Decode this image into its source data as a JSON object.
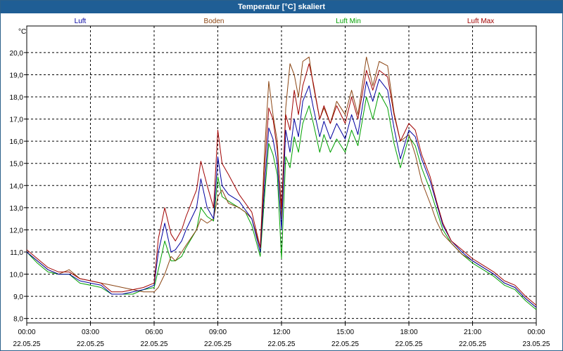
{
  "window": {
    "title": "Temperatur [°C] skaliert"
  },
  "legend": [
    {
      "name": "Luft",
      "color": "#0000a0"
    },
    {
      "name": "Boden",
      "color": "#8b4513"
    },
    {
      "name": "Luft Min",
      "color": "#00a000"
    },
    {
      "name": "Luft Max",
      "color": "#a00000"
    }
  ],
  "chart_data": {
    "type": "line",
    "title": "Temperatur [°C] skaliert",
    "xlabel": "",
    "ylabel": "°C",
    "unit_label": "°C",
    "ylim": [
      7.8,
      21.2
    ],
    "xlim": [
      0,
      24
    ],
    "grid": true,
    "grid_style": "dashed",
    "legend_position": "top",
    "y_ticks": [
      "8,0",
      "9,0",
      "10,0",
      "11,0",
      "12,0",
      "13,0",
      "14,0",
      "15,0",
      "16,0",
      "17,0",
      "18,0",
      "19,0",
      "20,0"
    ],
    "y_tick_values": [
      8,
      9,
      10,
      11,
      12,
      13,
      14,
      15,
      16,
      17,
      18,
      19,
      20
    ],
    "x_ticks": [
      {
        "time": "00:00",
        "date": "22.05.25"
      },
      {
        "time": "03:00",
        "date": "22.05.25"
      },
      {
        "time": "06:00",
        "date": "22.05.25"
      },
      {
        "time": "09:00",
        "date": "22.05.25"
      },
      {
        "time": "12:00",
        "date": "22.05.25"
      },
      {
        "time": "15:00",
        "date": "22.05.25"
      },
      {
        "time": "18:00",
        "date": "22.05.25"
      },
      {
        "time": "21:00",
        "date": "22.05.25"
      },
      {
        "time": "00:00",
        "date": "23.05.25"
      }
    ],
    "x_tick_values": [
      0,
      3,
      6,
      9,
      12,
      15,
      18,
      21,
      24
    ],
    "series": [
      {
        "name": "Luft",
        "color": "#0000a0",
        "x": [
          0,
          0.5,
          1,
          1.5,
          2,
          2.5,
          3,
          3.5,
          4,
          4.5,
          5,
          5.5,
          6,
          6.2,
          6.5,
          6.8,
          7,
          7.3,
          7.5,
          8,
          8.2,
          8.5,
          8.8,
          9,
          9.2,
          9.5,
          10,
          10.3,
          10.6,
          11,
          11.2,
          11.4,
          11.6,
          11.8,
          12,
          12.2,
          12.4,
          12.6,
          12.8,
          13,
          13.3,
          13.5,
          13.8,
          14,
          14.3,
          14.6,
          15,
          15.3,
          15.6,
          16,
          16.3,
          16.6,
          17,
          17.3,
          17.6,
          18,
          18.3,
          18.6,
          19,
          19.3,
          19.6,
          20,
          20.5,
          21,
          21.5,
          22,
          22.5,
          23,
          23.5,
          24
        ],
        "values": [
          11.0,
          10.6,
          10.2,
          10.0,
          10.0,
          9.7,
          9.6,
          9.5,
          9.1,
          9.1,
          9.2,
          9.3,
          9.5,
          11.0,
          12.3,
          11.0,
          11.1,
          11.5,
          12.0,
          13.0,
          14.3,
          13.0,
          12.5,
          15.3,
          14.0,
          13.6,
          13.3,
          12.9,
          12.5,
          11.0,
          14.0,
          16.6,
          16.1,
          15.0,
          12.0,
          16.5,
          15.5,
          17.0,
          16.2,
          17.8,
          18.5,
          17.5,
          16.2,
          16.9,
          16.1,
          16.8,
          16.1,
          17.2,
          16.3,
          18.7,
          17.8,
          18.8,
          18.3,
          16.6,
          15.2,
          16.5,
          16.2,
          15.2,
          14.2,
          13.2,
          12.2,
          11.5,
          11.0,
          10.6,
          10.3,
          10.0,
          9.6,
          9.4,
          8.9,
          8.5
        ]
      },
      {
        "name": "Boden",
        "color": "#8b4513",
        "x": [
          0,
          0.5,
          1,
          1.5,
          2,
          2.5,
          3,
          3.5,
          4,
          4.5,
          5,
          5.5,
          6,
          6.2,
          6.5,
          6.8,
          7,
          7.3,
          7.5,
          8,
          8.2,
          8.5,
          8.8,
          9,
          9.2,
          9.5,
          10,
          10.3,
          10.6,
          11,
          11.2,
          11.4,
          11.6,
          11.8,
          12,
          12.2,
          12.4,
          12.6,
          12.8,
          13,
          13.3,
          13.5,
          13.8,
          14,
          14.3,
          14.6,
          15,
          15.3,
          15.6,
          16,
          16.3,
          16.6,
          17,
          17.3,
          17.6,
          18,
          18.3,
          18.6,
          19,
          19.3,
          19.6,
          20,
          20.5,
          21,
          21.5,
          22,
          22.5,
          23,
          23.5,
          24
        ],
        "values": [
          11.0,
          10.6,
          10.2,
          10.0,
          10.2,
          9.8,
          9.7,
          9.6,
          9.5,
          9.4,
          9.3,
          9.2,
          9.2,
          9.4,
          10.0,
          10.8,
          10.6,
          11.0,
          11.3,
          12.0,
          12.5,
          12.3,
          12.5,
          13.5,
          13.8,
          13.2,
          13.0,
          12.8,
          12.5,
          11.2,
          15.5,
          18.7,
          17.2,
          16.0,
          12.5,
          17.5,
          19.5,
          19.0,
          18.0,
          19.6,
          19.8,
          18.5,
          17.0,
          17.5,
          16.8,
          17.8,
          17.2,
          18.3,
          17.2,
          19.8,
          18.5,
          19.6,
          19.4,
          17.3,
          16.0,
          16.3,
          15.4,
          14.2,
          13.2,
          12.4,
          11.8,
          11.4,
          10.9,
          10.6,
          10.3,
          10.0,
          9.6,
          9.4,
          8.9,
          8.5
        ]
      },
      {
        "name": "Luft Min",
        "color": "#00a000",
        "x": [
          0,
          0.5,
          1,
          1.5,
          2,
          2.5,
          3,
          3.5,
          4,
          4.5,
          5,
          5.5,
          6,
          6.2,
          6.5,
          6.8,
          7,
          7.3,
          7.5,
          8,
          8.2,
          8.5,
          8.8,
          9,
          9.2,
          9.5,
          10,
          10.3,
          10.6,
          11,
          11.2,
          11.4,
          11.6,
          11.8,
          12,
          12.2,
          12.4,
          12.6,
          12.8,
          13,
          13.3,
          13.5,
          13.8,
          14,
          14.3,
          14.6,
          15,
          15.3,
          15.6,
          16,
          16.3,
          16.6,
          17,
          17.3,
          17.6,
          18,
          18.3,
          18.6,
          19,
          19.3,
          19.6,
          20,
          20.5,
          21,
          21.5,
          22,
          22.5,
          23,
          23.5,
          24
        ],
        "values": [
          11.0,
          10.5,
          10.1,
          10.0,
          10.0,
          9.6,
          9.5,
          9.4,
          9.1,
          9.1,
          9.1,
          9.3,
          9.4,
          10.2,
          11.5,
          10.6,
          10.6,
          10.8,
          11.2,
          12.0,
          13.0,
          12.6,
          12.4,
          14.4,
          13.5,
          13.3,
          13.0,
          12.8,
          12.2,
          10.8,
          13.5,
          15.9,
          15.4,
          14.5,
          10.7,
          15.3,
          14.8,
          16.2,
          15.5,
          16.8,
          17.6,
          16.8,
          15.5,
          16.3,
          15.5,
          16.1,
          15.5,
          16.5,
          15.8,
          18.0,
          17.0,
          18.2,
          17.5,
          15.9,
          14.8,
          16.2,
          15.8,
          14.8,
          13.8,
          12.9,
          12.0,
          11.4,
          10.9,
          10.5,
          10.2,
          9.9,
          9.5,
          9.3,
          8.8,
          8.4
        ]
      },
      {
        "name": "Luft Max",
        "color": "#a00000",
        "x": [
          0,
          0.5,
          1,
          1.5,
          2,
          2.5,
          3,
          3.5,
          4,
          4.5,
          5,
          5.5,
          6,
          6.2,
          6.5,
          6.8,
          7,
          7.3,
          7.5,
          8,
          8.2,
          8.5,
          8.8,
          9,
          9.2,
          9.5,
          10,
          10.3,
          10.6,
          11,
          11.2,
          11.4,
          11.6,
          11.8,
          12,
          12.2,
          12.4,
          12.6,
          12.8,
          13,
          13.3,
          13.5,
          13.8,
          14,
          14.3,
          14.6,
          15,
          15.3,
          15.6,
          16,
          16.3,
          16.6,
          17,
          17.3,
          17.6,
          18,
          18.3,
          18.6,
          19,
          19.3,
          19.6,
          20,
          20.5,
          21,
          21.5,
          22,
          22.5,
          23,
          23.5,
          24
        ],
        "values": [
          11.1,
          10.7,
          10.3,
          10.1,
          10.1,
          9.8,
          9.7,
          9.6,
          9.2,
          9.2,
          9.3,
          9.4,
          9.6,
          11.6,
          13.0,
          11.8,
          11.5,
          12.0,
          12.6,
          13.8,
          15.1,
          14.0,
          13.0,
          16.5,
          15.0,
          14.5,
          13.6,
          13.2,
          12.8,
          11.2,
          14.8,
          17.5,
          17.0,
          15.6,
          13.0,
          17.2,
          16.5,
          18.3,
          17.2,
          18.5,
          19.5,
          18.6,
          17.0,
          17.6,
          16.8,
          17.6,
          16.8,
          18.0,
          17.0,
          19.2,
          18.3,
          19.2,
          18.9,
          17.2,
          16.0,
          16.8,
          16.5,
          15.4,
          14.4,
          13.3,
          12.3,
          11.5,
          11.1,
          10.7,
          10.4,
          10.1,
          9.7,
          9.5,
          9.0,
          8.6
        ]
      }
    ]
  }
}
